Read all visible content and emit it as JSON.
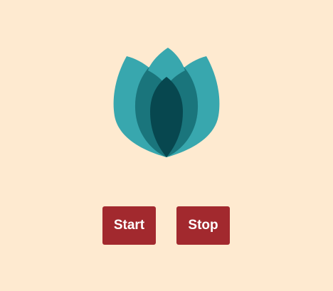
{
  "logo": {
    "icon": "lotus-icon",
    "colors": {
      "outer_petal": "#38a7ae",
      "middle_petal": "#1a757c",
      "inner_petal": "#07474f"
    }
  },
  "controls": {
    "start_label": "Start",
    "stop_label": "Stop",
    "button_color": "#a2292e"
  },
  "background_color": "#feead0"
}
